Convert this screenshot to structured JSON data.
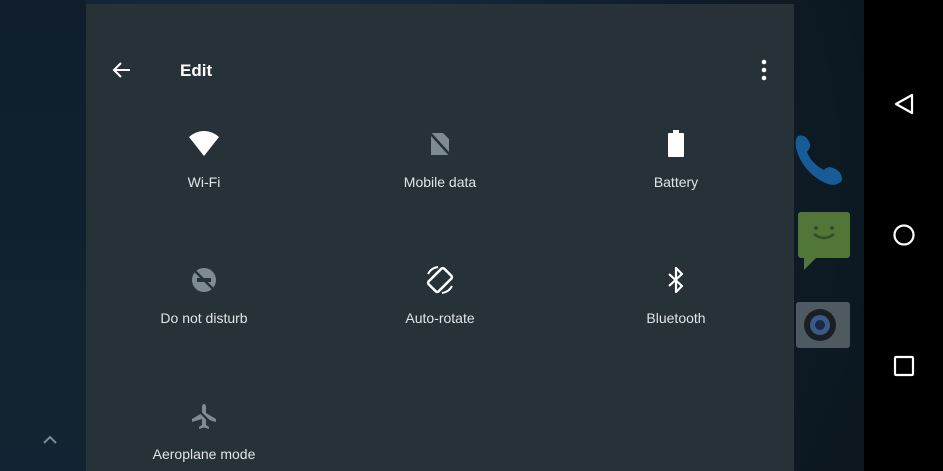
{
  "header": {
    "title": "Edit",
    "back_icon": "arrow-back-icon",
    "more_icon": "more-vert-icon"
  },
  "tiles": [
    {
      "label": "Wi-Fi",
      "icon": "wifi-icon",
      "active": true
    },
    {
      "label": "Mobile data",
      "icon": "mobile-data-off-icon",
      "active": false
    },
    {
      "label": "Battery",
      "icon": "battery-icon",
      "active": true
    },
    {
      "label": "Do not disturb",
      "icon": "do-not-disturb-off-icon",
      "active": false
    },
    {
      "label": "Auto-rotate",
      "icon": "auto-rotate-icon",
      "active": true
    },
    {
      "label": "Bluetooth",
      "icon": "bluetooth-icon",
      "active": true
    },
    {
      "label": "Aeroplane mode",
      "icon": "airplane-icon",
      "active": false
    }
  ],
  "navigation": {
    "back_icon": "nav-back-icon",
    "home_icon": "nav-home-icon",
    "recents_icon": "nav-recents-icon"
  },
  "colors": {
    "panel": "#263238",
    "active_icon": "#ffffff",
    "inactive_icon": "#7f8b92",
    "label": "#e0e4e6"
  }
}
